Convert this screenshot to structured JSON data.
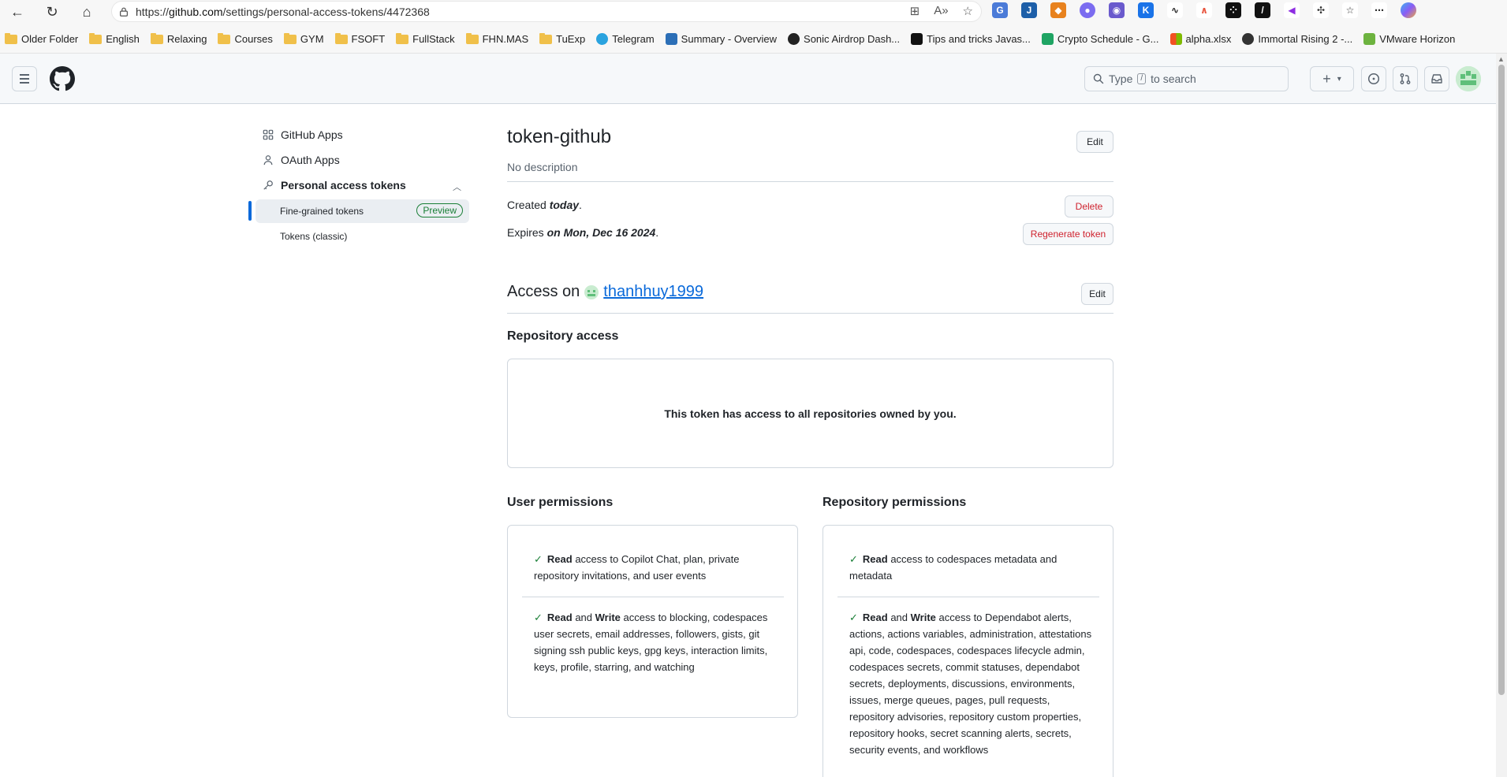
{
  "browser": {
    "url_prefix": "https://",
    "url_host": "github.com",
    "url_path": "/settings/personal-access-tokens/4472368",
    "bookmarks": [
      {
        "label": "Older Folder",
        "type": "folder"
      },
      {
        "label": "English",
        "type": "folder"
      },
      {
        "label": "Relaxing",
        "type": "folder"
      },
      {
        "label": "Courses",
        "type": "folder"
      },
      {
        "label": "GYM",
        "type": "folder"
      },
      {
        "label": "FSOFT",
        "type": "folder"
      },
      {
        "label": "FullStack",
        "type": "folder"
      },
      {
        "label": "FHN.MAS",
        "type": "folder"
      },
      {
        "label": "TuExp",
        "type": "folder"
      },
      {
        "label": "Telegram",
        "type": "site",
        "color": "#2aa3df"
      },
      {
        "label": "Summary - Overview",
        "type": "site",
        "color": "#2c6fb7"
      },
      {
        "label": "Sonic Airdrop Dash...",
        "type": "site",
        "color": "#222222"
      },
      {
        "label": "Tips and tricks Javas...",
        "type": "site",
        "color": "#111111"
      },
      {
        "label": "Crypto Schedule - G...",
        "type": "site",
        "color": "#1fa463"
      },
      {
        "label": "alpha.xlsx",
        "type": "site",
        "color": "#f25022"
      },
      {
        "label": "Immortal Rising 2 -...",
        "type": "site",
        "color": "#333333"
      },
      {
        "label": "VMware Horizon",
        "type": "site",
        "color": "#6db33f"
      }
    ]
  },
  "header": {
    "search_prefix": "Type",
    "search_key": "/",
    "search_suffix": "to search",
    "plus_label": "+",
    "caret_label": "▾"
  },
  "sidebar": {
    "items": [
      {
        "label": "GitHub Apps"
      },
      {
        "label": "OAuth Apps"
      },
      {
        "label": "Personal access tokens"
      }
    ],
    "sub_items": [
      {
        "label": "Fine-grained tokens",
        "badge": "Preview"
      },
      {
        "label": "Tokens (classic)"
      }
    ]
  },
  "token": {
    "name": "token-github",
    "description": "No description",
    "edit_label": "Edit",
    "created_prefix": "Created",
    "created_value": "today",
    "created_suffix": ".",
    "expires_prefix": "Expires",
    "expires_value": "on Mon, Dec 16 2024",
    "expires_suffix": ".",
    "delete_label": "Delete",
    "regenerate_label": "Regenerate token"
  },
  "access": {
    "title_prefix": "Access on",
    "owner": "thanhhuy1999",
    "edit_label": "Edit",
    "repo_access_title": "Repository access",
    "repo_access_text": "This token has access to all repositories owned by you."
  },
  "user_permissions": {
    "title": "User permissions",
    "items": [
      {
        "strong1": "Read",
        "mid": "",
        "strong2": "",
        "rest": " access to Copilot Chat, plan, private repository invitations, and user events"
      },
      {
        "strong1": "Read",
        "mid": " and ",
        "strong2": "Write",
        "rest": " access to blocking, codespaces user secrets, email addresses, followers, gists, git signing ssh public keys, gpg keys, interaction limits, keys, profile, starring, and watching"
      }
    ]
  },
  "repository_permissions": {
    "title": "Repository permissions",
    "items": [
      {
        "strong1": "Read",
        "mid": "",
        "strong2": "",
        "rest": " access to codespaces metadata and metadata"
      },
      {
        "strong1": "Read",
        "mid": " and ",
        "strong2": "Write",
        "rest": " access to Dependabot alerts, actions, actions variables, administration, attestations api, code, codespaces, codespaces lifecycle admin, codespaces secrets, commit statuses, dependabot secrets, deployments, discussions, environments, issues, merge queues, pages, pull requests, repository advisories, repository custom properties, repository hooks, secret scanning alerts, secrets, security events, and workflows"
      }
    ]
  },
  "colors": {
    "accent": "#0969da",
    "success": "#1a7f37",
    "danger": "#cf222e"
  }
}
